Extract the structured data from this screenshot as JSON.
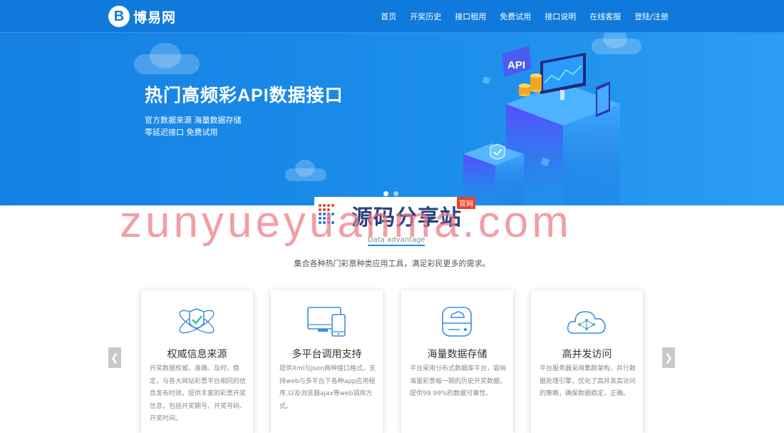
{
  "header": {
    "logo_letter": "B",
    "logo_text": "博易网",
    "nav": [
      "首页",
      "开奖历史",
      "接口租用",
      "免费试用",
      "接口说明",
      "在线客服",
      "登陆/注册"
    ]
  },
  "banner": {
    "title": "热门高频彩API数据接口",
    "subtitle_line1": "官方数据来源  海量数据存储",
    "subtitle_line2": "零延迟接口 免费试用",
    "illustration_label": "API"
  },
  "watermark": {
    "cn_text": "源码分享站",
    "tag": "官网",
    "url_text": "zunyueyuanma.com"
  },
  "section": {
    "en_title": "Data advantage",
    "description": "集合各种热门彩票种类应用工具，满足彩民更多的需求。",
    "prev_icon": "chevron-left-icon",
    "next_icon": "chevron-right-icon"
  },
  "cards": [
    {
      "icon": "shield-check-icon",
      "title": "权威信息来源",
      "text": "开奖数据权威、准确、及时，稳定，与各大网站彩票平台相同的信息发布时效。提供丰富的彩票开奖信息，包括开奖期号、开奖号码、开奖时间。"
    },
    {
      "icon": "devices-icon",
      "title": "多平台调用支持",
      "text": "提供Xml与Json两种接口格式，支持web与多平台下各种app应用程序,以及浏览器ajax等web调用方式。"
    },
    {
      "icon": "database-cloud-icon",
      "title": "海量数据存储",
      "text": "平台采用分布式数据库平台，容纳海量彩票每一期的历史开奖数据。提供99.99%的数据可靠性。"
    },
    {
      "icon": "cloud-network-icon",
      "title": "高并发访问",
      "text": "平台服务器采用集群架构，并行数据处理引擎，优化了高并发高访问的策略，确保数据稳定，正确。"
    }
  ],
  "colors": {
    "primary": "#0f79dc",
    "banner_start": "#1581e3",
    "banner_end": "#2b9df2",
    "watermark_pink": "#ec7882",
    "accent_green": "#35c48a"
  }
}
